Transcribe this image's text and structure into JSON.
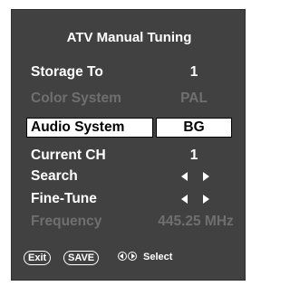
{
  "menu": {
    "title": "ATV Manual Tuning",
    "rows": [
      {
        "label": "Storage To",
        "value": "1",
        "state": "normal"
      },
      {
        "label": "Color System",
        "value": "PAL",
        "state": "disabled"
      },
      {
        "label": "Audio System",
        "value": "BG",
        "state": "selected"
      },
      {
        "label": "Current CH",
        "value": "1",
        "state": "normal"
      },
      {
        "label": "Search",
        "value": "",
        "control": "left-right-arrows",
        "state": "normal"
      },
      {
        "label": "Fine-Tune",
        "value": "",
        "control": "left-right-arrows",
        "state": "normal"
      },
      {
        "label": "Frequency",
        "value": "445.25 MHz",
        "state": "disabled"
      }
    ]
  },
  "footer": {
    "exit_label": "Exit",
    "save_label": "SAVE",
    "nav_icon": "left-right-circle-arrows-icon",
    "select_label": "Select"
  },
  "colors": {
    "panel": "#414141",
    "text": "#ffffff",
    "disabled_text": "#6f6f6f",
    "selected_bg": "#ffffff",
    "selected_text": "#000000"
  }
}
